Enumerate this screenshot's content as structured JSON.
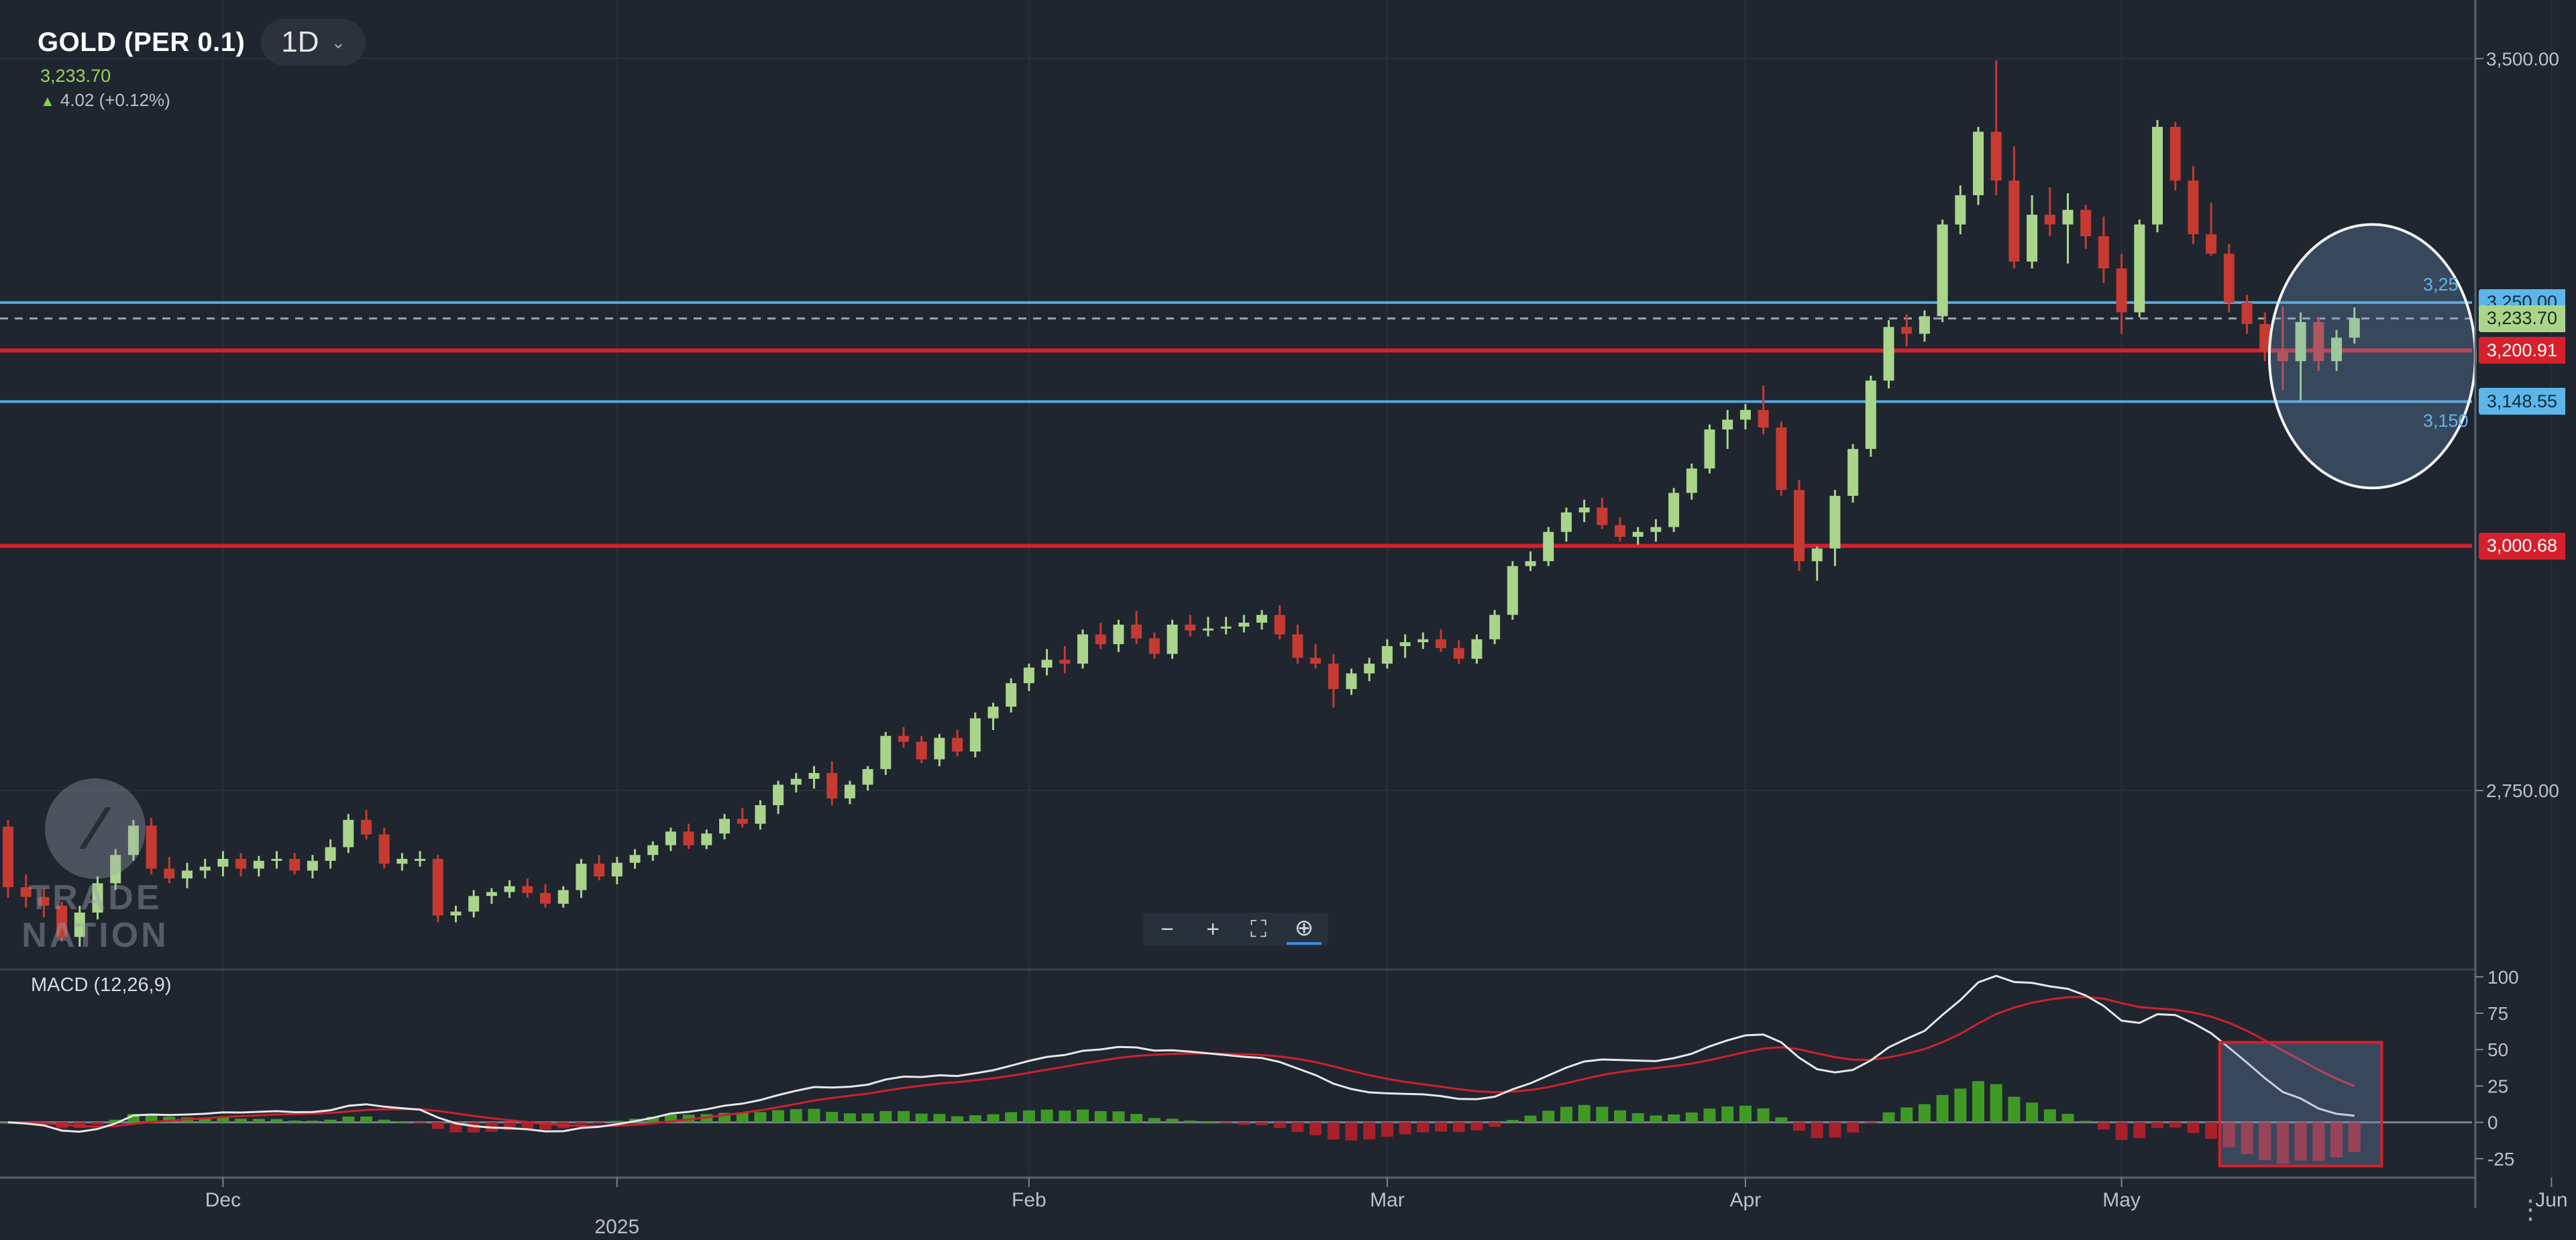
{
  "header": {
    "symbol": "GOLD (PER 0.1)",
    "timeframe": "1D",
    "price": "3,233.70",
    "change": "4.02 (+0.12%)"
  },
  "indicator": {
    "label": "MACD (12,26,9)"
  },
  "watermark": {
    "line1": "TRADE",
    "line2": "NATION"
  },
  "zoom_controls": [
    "minus-icon",
    "plus-icon",
    "fullscreen-icon",
    "zoom-icon"
  ],
  "colors": {
    "background": "#1f2630",
    "up": "#a9d58b",
    "down": "#c63a32",
    "resistance_line": "#d6202c",
    "support_line": "#56a9e0",
    "macd_line": "#e8e8e8",
    "signal_line": "#d0202e",
    "hist_up": "#3f9a25",
    "hist_down": "#a8202a"
  },
  "chart_data": {
    "type": "candlestick",
    "price_axis": {
      "ticks": [
        {
          "value": 3500,
          "label": "3,500.00"
        },
        {
          "value": 2750,
          "label": "2,750.00"
        }
      ],
      "ylim": [
        2570,
        3560
      ]
    },
    "x_axis": {
      "labels": [
        {
          "label": "Dec",
          "index": 12
        },
        {
          "label": "2025",
          "index": 34
        },
        {
          "label": "Feb",
          "index": 57
        },
        {
          "label": "Mar",
          "index": 77
        },
        {
          "label": "Apr",
          "index": 97
        },
        {
          "label": "May",
          "index": 118
        },
        {
          "label": "Jun",
          "index": 142
        }
      ]
    },
    "candles": [
      [
        2713,
        2720,
        2640,
        2651
      ],
      [
        2651,
        2664,
        2630,
        2641
      ],
      [
        2641,
        2650,
        2620,
        2632
      ],
      [
        2632,
        2636,
        2595,
        2600
      ],
      [
        2600,
        2632,
        2590,
        2625
      ],
      [
        2625,
        2662,
        2618,
        2655
      ],
      [
        2655,
        2690,
        2648,
        2684
      ],
      [
        2684,
        2720,
        2678,
        2714
      ],
      [
        2714,
        2722,
        2664,
        2670
      ],
      [
        2670,
        2682,
        2655,
        2660
      ],
      [
        2660,
        2676,
        2650,
        2668
      ],
      [
        2668,
        2680,
        2660,
        2672
      ],
      [
        2672,
        2688,
        2662,
        2680
      ],
      [
        2680,
        2686,
        2662,
        2670
      ],
      [
        2670,
        2683,
        2662,
        2678
      ],
      [
        2678,
        2688,
        2670,
        2680
      ],
      [
        2680,
        2686,
        2664,
        2668
      ],
      [
        2668,
        2684,
        2660,
        2678
      ],
      [
        2678,
        2700,
        2670,
        2692
      ],
      [
        2692,
        2726,
        2686,
        2720
      ],
      [
        2720,
        2730,
        2700,
        2705
      ],
      [
        2705,
        2712,
        2670,
        2675
      ],
      [
        2675,
        2686,
        2668,
        2680
      ],
      [
        2680,
        2688,
        2672,
        2680
      ],
      [
        2680,
        2684,
        2615,
        2622
      ],
      [
        2622,
        2632,
        2615,
        2626
      ],
      [
        2626,
        2648,
        2620,
        2642
      ],
      [
        2642,
        2650,
        2634,
        2646
      ],
      [
        2646,
        2658,
        2640,
        2652
      ],
      [
        2652,
        2660,
        2640,
        2645
      ],
      [
        2645,
        2654,
        2630,
        2634
      ],
      [
        2634,
        2652,
        2630,
        2648
      ],
      [
        2648,
        2680,
        2640,
        2675
      ],
      [
        2675,
        2684,
        2658,
        2662
      ],
      [
        2662,
        2682,
        2654,
        2676
      ],
      [
        2676,
        2690,
        2670,
        2684
      ],
      [
        2684,
        2698,
        2678,
        2694
      ],
      [
        2694,
        2712,
        2688,
        2708
      ],
      [
        2708,
        2716,
        2690,
        2694
      ],
      [
        2694,
        2710,
        2690,
        2706
      ],
      [
        2706,
        2726,
        2700,
        2721
      ],
      [
        2721,
        2732,
        2712,
        2716
      ],
      [
        2716,
        2740,
        2710,
        2735
      ],
      [
        2735,
        2760,
        2726,
        2756
      ],
      [
        2756,
        2768,
        2748,
        2762
      ],
      [
        2762,
        2775,
        2752,
        2768
      ],
      [
        2768,
        2780,
        2735,
        2742
      ],
      [
        2742,
        2760,
        2736,
        2756
      ],
      [
        2756,
        2775,
        2750,
        2772
      ],
      [
        2772,
        2810,
        2766,
        2806
      ],
      [
        2806,
        2815,
        2794,
        2800
      ],
      [
        2800,
        2806,
        2778,
        2782
      ],
      [
        2782,
        2808,
        2775,
        2804
      ],
      [
        2804,
        2812,
        2785,
        2790
      ],
      [
        2790,
        2830,
        2784,
        2824
      ],
      [
        2824,
        2840,
        2812,
        2836
      ],
      [
        2836,
        2865,
        2830,
        2860
      ],
      [
        2860,
        2880,
        2852,
        2876
      ],
      [
        2876,
        2895,
        2868,
        2884
      ],
      [
        2884,
        2898,
        2870,
        2880
      ],
      [
        2880,
        2915,
        2875,
        2910
      ],
      [
        2910,
        2922,
        2895,
        2900
      ],
      [
        2900,
        2925,
        2892,
        2920
      ],
      [
        2920,
        2934,
        2900,
        2906
      ],
      [
        2906,
        2912,
        2885,
        2890
      ],
      [
        2890,
        2925,
        2885,
        2920
      ],
      [
        2920,
        2930,
        2908,
        2914
      ],
      [
        2914,
        2928,
        2908,
        2916
      ],
      [
        2916,
        2928,
        2910,
        2918
      ],
      [
        2918,
        2930,
        2912,
        2922
      ],
      [
        2922,
        2935,
        2915,
        2930
      ],
      [
        2930,
        2940,
        2905,
        2910
      ],
      [
        2910,
        2920,
        2880,
        2886
      ],
      [
        2886,
        2900,
        2875,
        2880
      ],
      [
        2880,
        2890,
        2835,
        2854
      ],
      [
        2854,
        2875,
        2848,
        2870
      ],
      [
        2870,
        2886,
        2862,
        2880
      ],
      [
        2880,
        2905,
        2875,
        2898
      ],
      [
        2898,
        2910,
        2886,
        2902
      ],
      [
        2902,
        2912,
        2895,
        2905
      ],
      [
        2905,
        2915,
        2892,
        2896
      ],
      [
        2896,
        2904,
        2880,
        2885
      ],
      [
        2885,
        2910,
        2880,
        2905
      ],
      [
        2905,
        2935,
        2900,
        2930
      ],
      [
        2930,
        2985,
        2925,
        2980
      ],
      [
        2980,
        2995,
        2975,
        2985
      ],
      [
        2985,
        3020,
        2980,
        3015
      ],
      [
        3015,
        3040,
        3005,
        3035
      ],
      [
        3035,
        3048,
        3025,
        3040
      ],
      [
        3040,
        3050,
        3018,
        3022
      ],
      [
        3022,
        3030,
        3005,
        3010
      ],
      [
        3010,
        3020,
        3002,
        3015
      ],
      [
        3015,
        3028,
        3005,
        3020
      ],
      [
        3020,
        3060,
        3015,
        3055
      ],
      [
        3055,
        3085,
        3048,
        3080
      ],
      [
        3080,
        3125,
        3075,
        3120
      ],
      [
        3120,
        3140,
        3100,
        3130
      ],
      [
        3130,
        3146,
        3120,
        3140
      ],
      [
        3140,
        3165,
        3115,
        3122
      ],
      [
        3122,
        3128,
        3052,
        3058
      ],
      [
        3058,
        3068,
        2975,
        2985
      ],
      [
        2985,
        3000,
        2965,
        2998
      ],
      [
        2998,
        3058,
        2980,
        3052
      ],
      [
        3052,
        3105,
        3045,
        3100
      ],
      [
        3100,
        3175,
        3092,
        3170
      ],
      [
        3170,
        3232,
        3162,
        3225
      ],
      [
        3225,
        3238,
        3205,
        3218
      ],
      [
        3218,
        3242,
        3210,
        3236
      ],
      [
        3236,
        3335,
        3230,
        3330
      ],
      [
        3330,
        3370,
        3320,
        3360
      ],
      [
        3360,
        3430,
        3350,
        3425
      ],
      [
        3425,
        3498,
        3360,
        3375
      ],
      [
        3375,
        3410,
        3285,
        3292
      ],
      [
        3292,
        3360,
        3285,
        3340
      ],
      [
        3340,
        3368,
        3318,
        3330
      ],
      [
        3330,
        3362,
        3290,
        3345
      ],
      [
        3345,
        3350,
        3305,
        3318
      ],
      [
        3318,
        3338,
        3270,
        3285
      ],
      [
        3285,
        3300,
        3218,
        3240
      ],
      [
        3240,
        3335,
        3235,
        3330
      ],
      [
        3330,
        3437,
        3322,
        3430
      ],
      [
        3430,
        3435,
        3365,
        3375
      ],
      [
        3375,
        3390,
        3310,
        3320
      ],
      [
        3320,
        3352,
        3298,
        3300
      ],
      [
        3300,
        3310,
        3240,
        3250
      ],
      [
        3250,
        3258,
        3218,
        3228
      ],
      [
        3228,
        3240,
        3190,
        3200
      ],
      [
        3200,
        3246,
        3160,
        3190
      ],
      [
        3190,
        3240,
        3150,
        3230
      ],
      [
        3230,
        3235,
        3180,
        3190
      ],
      [
        3190,
        3222,
        3180,
        3214
      ],
      [
        3214,
        3245,
        3208,
        3234
      ]
    ],
    "horizontal_lines": [
      {
        "value": 3250.0,
        "label": "3,250.00",
        "color": "support",
        "axis_hint": "3,25"
      },
      {
        "value": 3233.7,
        "label": "3,233.70",
        "color": "current"
      },
      {
        "value": 3200.91,
        "label": "3,200.91",
        "color": "resistance"
      },
      {
        "value": 3148.55,
        "label": "3,148.55",
        "color": "support",
        "axis_hint": "3,150"
      },
      {
        "value": 3000.68,
        "label": "3,000.68",
        "color": "resistance"
      }
    ],
    "highlight_ellipse": {
      "from_index": 127,
      "to_index": 137,
      "center_price": 3195,
      "half_range": 135
    },
    "macd": {
      "ylim": [
        -38,
        105
      ],
      "ticks": [
        {
          "value": 100,
          "label": "100"
        },
        {
          "value": 75,
          "label": "75"
        },
        {
          "value": 50,
          "label": "50"
        },
        {
          "value": 25,
          "label": "25"
        },
        {
          "value": 0,
          "label": "0"
        },
        {
          "value": -25,
          "label": "-25"
        }
      ],
      "highlight_box": {
        "from_index": 124,
        "to_index": 132,
        "y_top": 55,
        "y_bottom": -30
      }
    }
  }
}
